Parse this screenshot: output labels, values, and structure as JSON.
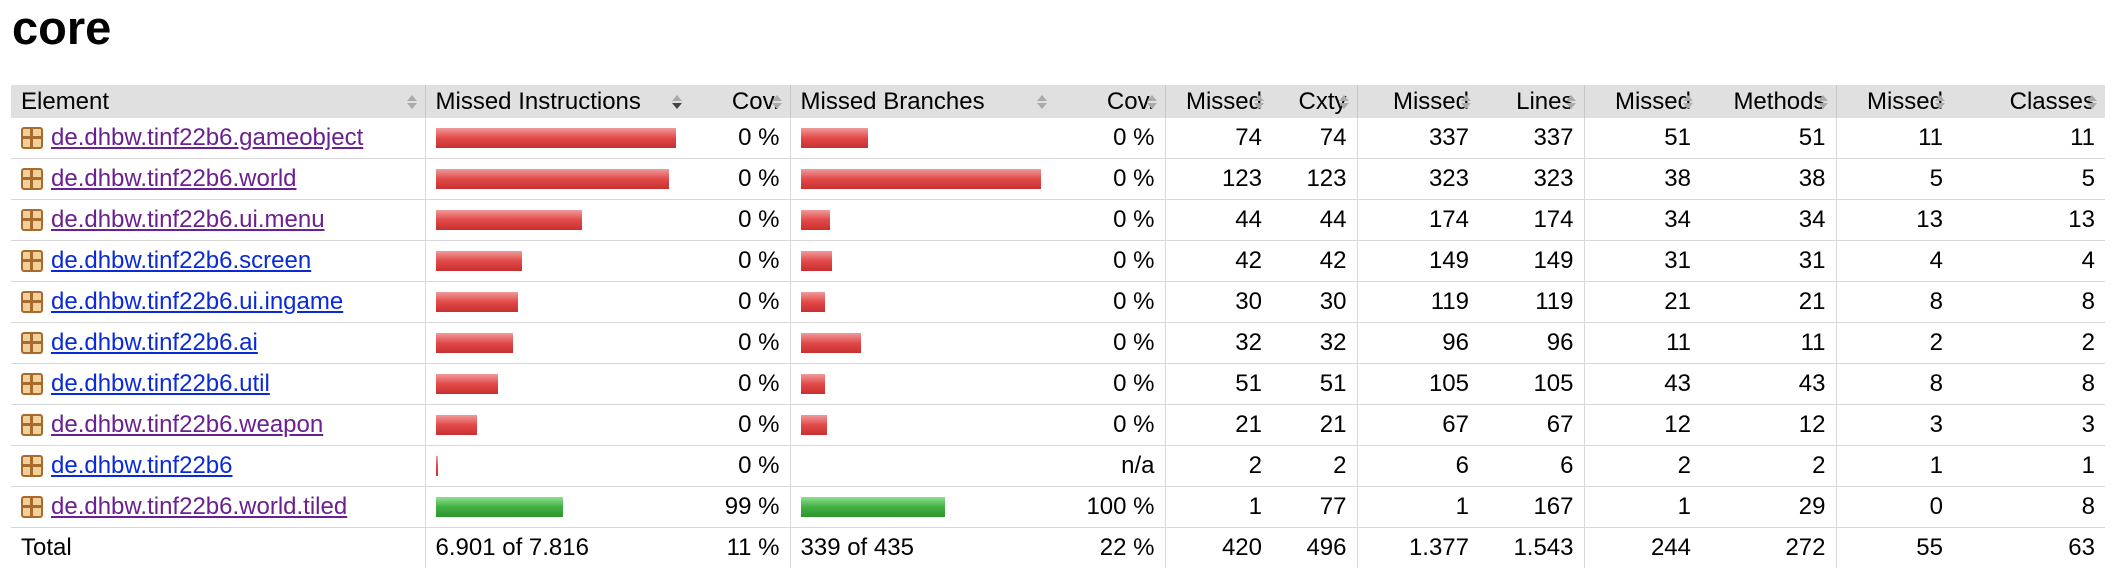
{
  "page": {
    "title": "core"
  },
  "headers": {
    "element": "Element",
    "missed_instructions": "Missed Instructions",
    "cov_instr": "Cov.",
    "missed_branches": "Missed Branches",
    "cov_branch": "Cov.",
    "missed_cxty": "Missed",
    "cxty": "Cxty",
    "missed_lines": "Missed",
    "lines": "Lines",
    "missed_methods": "Missed",
    "methods": "Methods",
    "missed_classes": "Missed",
    "classes": "Classes"
  },
  "rows": [
    {
      "name": "de.dhbw.tinf22b6.gameobject",
      "visited": true,
      "instr_missed_frac": 1.0,
      "instr_covered_frac": 0.0,
      "instr_cov": "0 %",
      "branch_missed_frac": 0.28,
      "branch_covered_frac": 0.0,
      "branch_cov": "0 %",
      "missed_cxty": "74",
      "cxty": "74",
      "missed_lines": "337",
      "lines": "337",
      "missed_methods": "51",
      "methods": "51",
      "missed_classes": "11",
      "classes": "11"
    },
    {
      "name": "de.dhbw.tinf22b6.world",
      "visited": true,
      "instr_missed_frac": 0.97,
      "instr_covered_frac": 0.0,
      "instr_cov": "0 %",
      "branch_missed_frac": 1.0,
      "branch_covered_frac": 0.0,
      "branch_cov": "0 %",
      "missed_cxty": "123",
      "cxty": "123",
      "missed_lines": "323",
      "lines": "323",
      "missed_methods": "38",
      "methods": "38",
      "missed_classes": "5",
      "classes": "5"
    },
    {
      "name": "de.dhbw.tinf22b6.ui.menu",
      "visited": true,
      "instr_missed_frac": 0.61,
      "instr_covered_frac": 0.0,
      "instr_cov": "0 %",
      "branch_missed_frac": 0.12,
      "branch_covered_frac": 0.0,
      "branch_cov": "0 %",
      "missed_cxty": "44",
      "cxty": "44",
      "missed_lines": "174",
      "lines": "174",
      "missed_methods": "34",
      "methods": "34",
      "missed_classes": "13",
      "classes": "13"
    },
    {
      "name": "de.dhbw.tinf22b6.screen",
      "visited": false,
      "instr_missed_frac": 0.36,
      "instr_covered_frac": 0.0,
      "instr_cov": "0 %",
      "branch_missed_frac": 0.13,
      "branch_covered_frac": 0.0,
      "branch_cov": "0 %",
      "missed_cxty": "42",
      "cxty": "42",
      "missed_lines": "149",
      "lines": "149",
      "missed_methods": "31",
      "methods": "31",
      "missed_classes": "4",
      "classes": "4"
    },
    {
      "name": "de.dhbw.tinf22b6.ui.ingame",
      "visited": false,
      "instr_missed_frac": 0.34,
      "instr_covered_frac": 0.0,
      "instr_cov": "0 %",
      "branch_missed_frac": 0.1,
      "branch_covered_frac": 0.0,
      "branch_cov": "0 %",
      "missed_cxty": "30",
      "cxty": "30",
      "missed_lines": "119",
      "lines": "119",
      "missed_methods": "21",
      "methods": "21",
      "missed_classes": "8",
      "classes": "8"
    },
    {
      "name": "de.dhbw.tinf22b6.ai",
      "visited": false,
      "instr_missed_frac": 0.32,
      "instr_covered_frac": 0.0,
      "instr_cov": "0 %",
      "branch_missed_frac": 0.25,
      "branch_covered_frac": 0.0,
      "branch_cov": "0 %",
      "missed_cxty": "32",
      "cxty": "32",
      "missed_lines": "96",
      "lines": "96",
      "missed_methods": "11",
      "methods": "11",
      "missed_classes": "2",
      "classes": "2"
    },
    {
      "name": "de.dhbw.tinf22b6.util",
      "visited": false,
      "instr_missed_frac": 0.26,
      "instr_covered_frac": 0.0,
      "instr_cov": "0 %",
      "branch_missed_frac": 0.1,
      "branch_covered_frac": 0.0,
      "branch_cov": "0 %",
      "missed_cxty": "51",
      "cxty": "51",
      "missed_lines": "105",
      "lines": "105",
      "missed_methods": "43",
      "methods": "43",
      "missed_classes": "8",
      "classes": "8"
    },
    {
      "name": "de.dhbw.tinf22b6.weapon",
      "visited": true,
      "instr_missed_frac": 0.17,
      "instr_covered_frac": 0.0,
      "instr_cov": "0 %",
      "branch_missed_frac": 0.11,
      "branch_covered_frac": 0.0,
      "branch_cov": "0 %",
      "missed_cxty": "21",
      "cxty": "21",
      "missed_lines": "67",
      "lines": "67",
      "missed_methods": "12",
      "methods": "12",
      "missed_classes": "3",
      "classes": "3"
    },
    {
      "name": "de.dhbw.tinf22b6",
      "visited": false,
      "instr_missed_frac": 0.01,
      "instr_covered_frac": 0.0,
      "instr_cov": "0 %",
      "branch_missed_frac": 0.0,
      "branch_covered_frac": 0.0,
      "branch_cov": "n/a",
      "missed_cxty": "2",
      "cxty": "2",
      "missed_lines": "6",
      "lines": "6",
      "missed_methods": "2",
      "methods": "2",
      "missed_classes": "1",
      "classes": "1"
    },
    {
      "name": "de.dhbw.tinf22b6.world.tiled",
      "visited": true,
      "instr_missed_frac": 0.0,
      "instr_covered_frac": 0.53,
      "instr_cov": "99 %",
      "branch_missed_frac": 0.0,
      "branch_covered_frac": 0.6,
      "branch_cov": "100 %",
      "missed_cxty": "1",
      "cxty": "77",
      "missed_lines": "1",
      "lines": "167",
      "missed_methods": "1",
      "methods": "29",
      "missed_classes": "0",
      "classes": "8"
    }
  ],
  "total": {
    "label": "Total",
    "missed_instructions": "6.901 of 7.816",
    "instr_cov": "11 %",
    "missed_branches": "339 of 435",
    "branch_cov": "22 %",
    "missed_cxty": "420",
    "cxty": "496",
    "missed_lines": "1.377",
    "lines": "1.543",
    "missed_methods": "244",
    "methods": "272",
    "missed_classes": "55",
    "classes": "63"
  },
  "colors": {
    "header_bg": "#e0e0e0",
    "bar_missed": "#e24a4a",
    "bar_covered": "#40b040",
    "link_visited": "#6a2090",
    "link": "#0a2ad8"
  }
}
